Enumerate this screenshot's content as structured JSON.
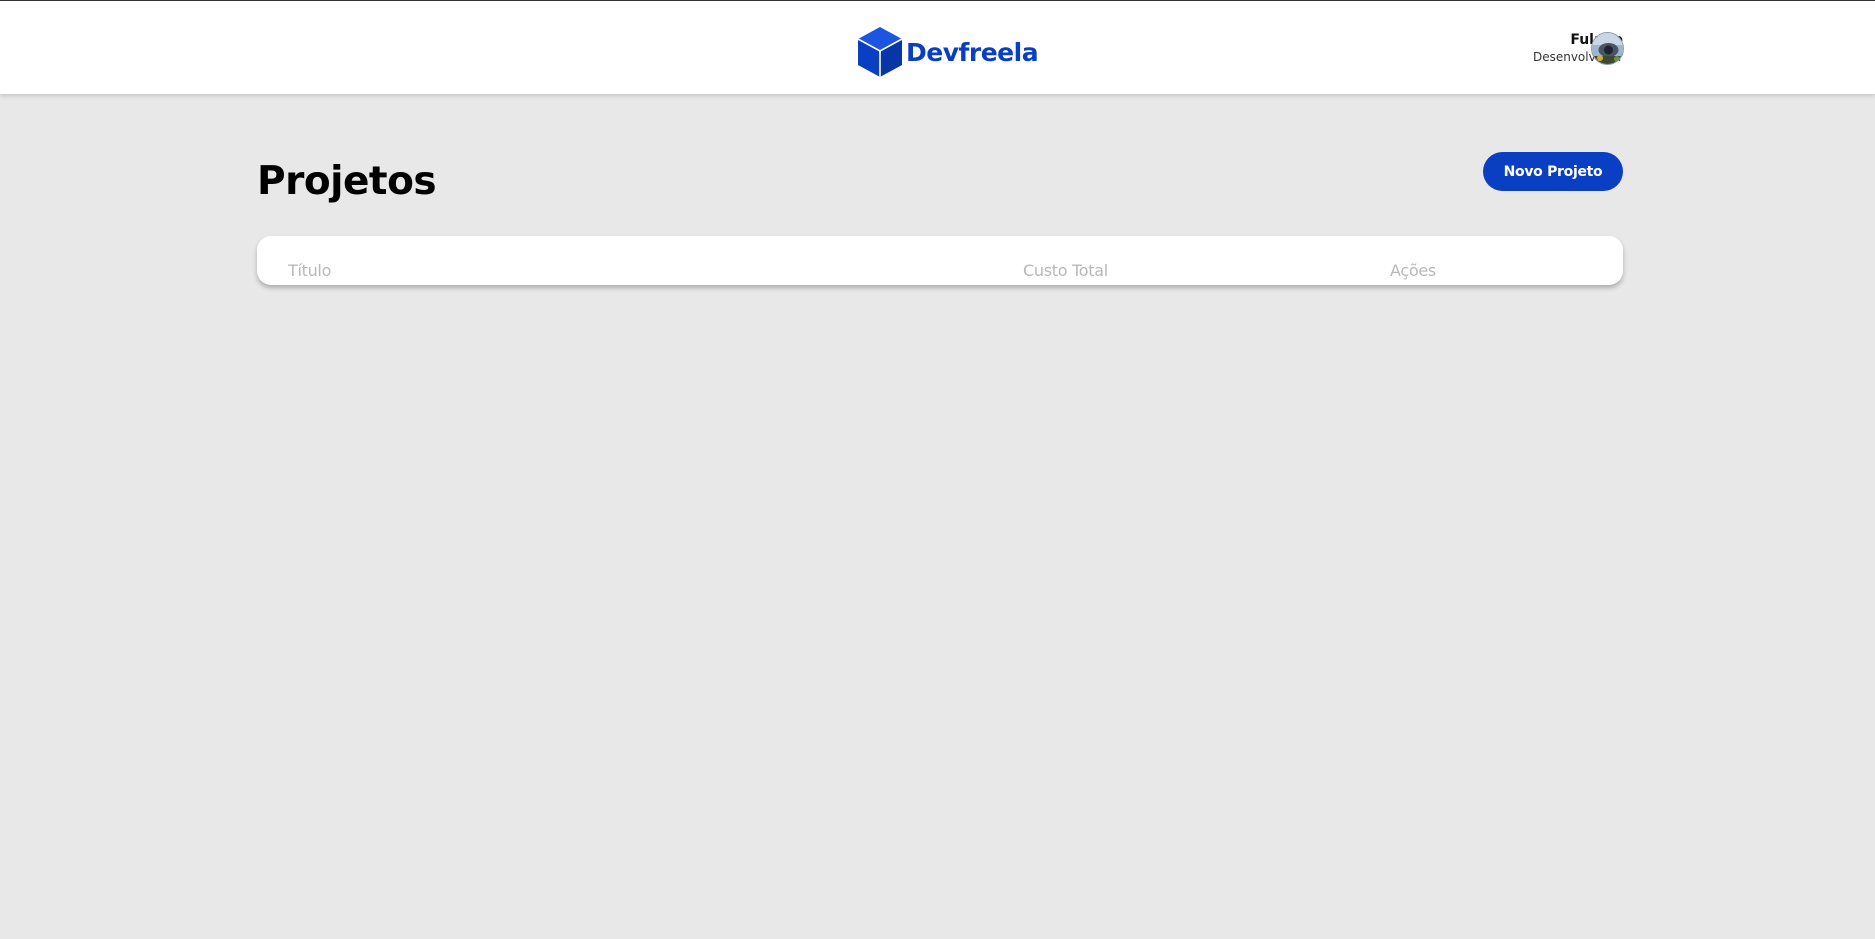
{
  "header": {
    "brand": "Devfreela",
    "logo_icon": "cube-icon",
    "user": {
      "name": "Fulano",
      "role": "Desenvolvedor",
      "avatar_icon": "avatar"
    }
  },
  "main": {
    "title": "Projetos",
    "new_project_label": "Novo Projeto",
    "table": {
      "columns": [
        "Título",
        "Custo Total",
        "Ações"
      ],
      "rows": []
    }
  },
  "colors": {
    "primary": "#0a3fc4",
    "background": "#e8e8e8",
    "surface": "#ffffff",
    "muted_text": "#b8b8b8"
  }
}
